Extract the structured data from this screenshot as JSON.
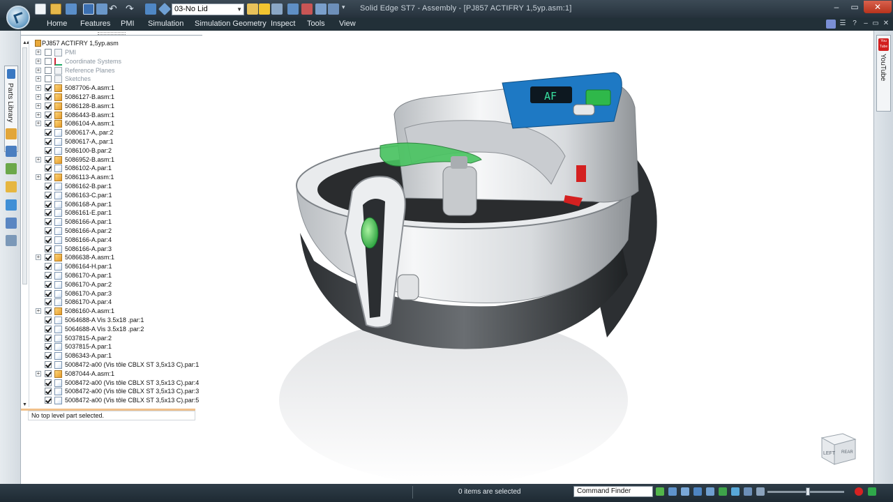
{
  "titlebar": {
    "window_title": "Solid Edge ST7 - Assembly - [PJ857 ACTIFRY 1,5yp.asm:1]",
    "configuration": "03-No Lid",
    "minimize": "–",
    "restore": "▭",
    "close": "✕"
  },
  "ribbon": {
    "tabs": [
      "Home",
      "Features",
      "PMI",
      "Simulation",
      "Simulation Geometry",
      "Inspect",
      "Tools",
      "View"
    ]
  },
  "left_strip": {
    "parts_library_label": "Parts Library"
  },
  "right_strip": {
    "youtube_badge": "You Tube",
    "youtube_label": "YouTube"
  },
  "pathfinder": {
    "root": "PJ857 ACTIFRY 1,5yp.asm",
    "items": [
      {
        "label": "PMI",
        "kind": "ref",
        "checked": false,
        "expand": true,
        "dim": true
      },
      {
        "label": "Coordinate Systems",
        "kind": "coord",
        "checked": false,
        "expand": true,
        "dim": true
      },
      {
        "label": "Reference Planes",
        "kind": "ref",
        "checked": false,
        "expand": true,
        "dim": true
      },
      {
        "label": "Sketches",
        "kind": "ref",
        "checked": false,
        "expand": true,
        "dim": true
      },
      {
        "label": "5087706-A.asm:1",
        "kind": "asm",
        "checked": true,
        "expand": true
      },
      {
        "label": "5086127-B.asm:1",
        "kind": "asm",
        "checked": true,
        "expand": true
      },
      {
        "label": "5086128-B.asm:1",
        "kind": "asm",
        "checked": true,
        "expand": true
      },
      {
        "label": "5086443-B.asm:1",
        "kind": "asm",
        "checked": true,
        "expand": true
      },
      {
        "label": "5086104-A.asm:1",
        "kind": "asm",
        "checked": true,
        "expand": true
      },
      {
        "label": "5080617-A,.par:2",
        "kind": "part",
        "checked": true,
        "expand": false
      },
      {
        "label": "5080617-A,.par:1",
        "kind": "part",
        "checked": true,
        "expand": false
      },
      {
        "label": "5086100-B.par:2",
        "kind": "part",
        "checked": true,
        "expand": false
      },
      {
        "label": "5086952-B.asm:1",
        "kind": "asm",
        "checked": true,
        "expand": true
      },
      {
        "label": "5086102-A.par:1",
        "kind": "part",
        "checked": true,
        "expand": false
      },
      {
        "label": "5086113-A.asm:1",
        "kind": "asm",
        "checked": true,
        "expand": true
      },
      {
        "label": "5086162-B.par:1",
        "kind": "part",
        "checked": true,
        "expand": false
      },
      {
        "label": "5086163-C.par:1",
        "kind": "part",
        "checked": true,
        "expand": false
      },
      {
        "label": "5086168-A.par:1",
        "kind": "part",
        "checked": true,
        "expand": false
      },
      {
        "label": "5086161-E.par:1",
        "kind": "part",
        "checked": true,
        "expand": false
      },
      {
        "label": "5086166-A.par:1",
        "kind": "part",
        "checked": true,
        "expand": false
      },
      {
        "label": "5086166-A.par:2",
        "kind": "part",
        "checked": true,
        "expand": false
      },
      {
        "label": "5086166-A.par:4",
        "kind": "part",
        "checked": true,
        "expand": false
      },
      {
        "label": "5086166-A.par:3",
        "kind": "part",
        "checked": true,
        "expand": false
      },
      {
        "label": "5086638-A.asm:1",
        "kind": "asm",
        "checked": true,
        "expand": true
      },
      {
        "label": "5086164-H.par:1",
        "kind": "part",
        "checked": true,
        "expand": false
      },
      {
        "label": "5086170-A.par:1",
        "kind": "part",
        "checked": true,
        "expand": false
      },
      {
        "label": "5086170-A.par:2",
        "kind": "part",
        "checked": true,
        "expand": false
      },
      {
        "label": "5086170-A.par:3",
        "kind": "part",
        "checked": true,
        "expand": false
      },
      {
        "label": "5086170-A.par:4",
        "kind": "part",
        "checked": true,
        "expand": false
      },
      {
        "label": "5086160-A.asm:1",
        "kind": "asm",
        "checked": true,
        "expand": true
      },
      {
        "label": "5064688-A Vis 3.5x18 .par:1",
        "kind": "part",
        "checked": true,
        "expand": false
      },
      {
        "label": "5064688-A Vis 3.5x18 .par:2",
        "kind": "part",
        "checked": true,
        "expand": false
      },
      {
        "label": "5037815-A.par:2",
        "kind": "part",
        "checked": true,
        "expand": false
      },
      {
        "label": "5037815-A.par:1",
        "kind": "part",
        "checked": true,
        "expand": false
      },
      {
        "label": "5086343-A.par:1",
        "kind": "part",
        "checked": true,
        "expand": false
      },
      {
        "label": "5008472-a00 (Vis tôle CBLX ST 3,5x13 C).par:1",
        "kind": "part",
        "checked": true,
        "expand": false
      },
      {
        "label": "5087044-A.asm:1",
        "kind": "asm",
        "checked": true,
        "expand": true
      },
      {
        "label": "5008472-a00 (Vis tôle CBLX ST 3,5x13 C).par:4",
        "kind": "part",
        "checked": true,
        "expand": false
      },
      {
        "label": "5008472-a00 (Vis tôle CBLX ST 3,5x13 C).par:3",
        "kind": "part",
        "checked": true,
        "expand": false
      },
      {
        "label": "5008472-a00 (Vis tôle CBLX ST 3,5x13 C).par:5",
        "kind": "part",
        "checked": true,
        "expand": false
      }
    ],
    "status": "No top level part selected."
  },
  "viewport": {
    "view_cube_face": "LEFT",
    "view_cube_side": "REAR",
    "display_readout": "AF"
  },
  "statusbar": {
    "selected_count": "0 items are selected",
    "command_finder_placeholder": "Command Finder"
  },
  "colors": {
    "titlebar": "#2f3c47",
    "ribbon": "#223038",
    "accent_green": "#2fb84a",
    "accent_red": "#d42020",
    "panel_blue": "#1e79c4"
  }
}
